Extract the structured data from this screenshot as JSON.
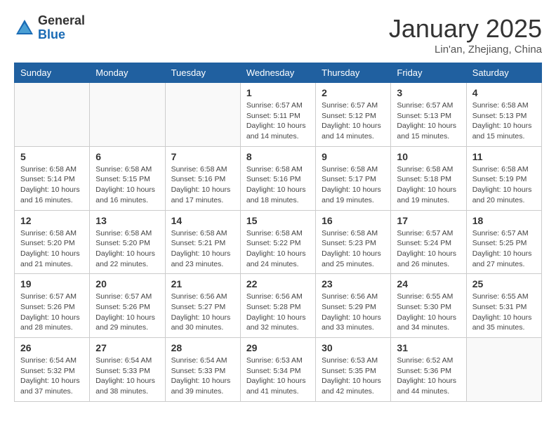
{
  "header": {
    "logo_general": "General",
    "logo_blue": "Blue",
    "month": "January 2025",
    "location": "Lin'an, Zhejiang, China"
  },
  "days_of_week": [
    "Sunday",
    "Monday",
    "Tuesday",
    "Wednesday",
    "Thursday",
    "Friday",
    "Saturday"
  ],
  "weeks": [
    [
      {
        "num": "",
        "info": ""
      },
      {
        "num": "",
        "info": ""
      },
      {
        "num": "",
        "info": ""
      },
      {
        "num": "1",
        "info": "Sunrise: 6:57 AM\nSunset: 5:11 PM\nDaylight: 10 hours\nand 14 minutes."
      },
      {
        "num": "2",
        "info": "Sunrise: 6:57 AM\nSunset: 5:12 PM\nDaylight: 10 hours\nand 14 minutes."
      },
      {
        "num": "3",
        "info": "Sunrise: 6:57 AM\nSunset: 5:13 PM\nDaylight: 10 hours\nand 15 minutes."
      },
      {
        "num": "4",
        "info": "Sunrise: 6:58 AM\nSunset: 5:13 PM\nDaylight: 10 hours\nand 15 minutes."
      }
    ],
    [
      {
        "num": "5",
        "info": "Sunrise: 6:58 AM\nSunset: 5:14 PM\nDaylight: 10 hours\nand 16 minutes."
      },
      {
        "num": "6",
        "info": "Sunrise: 6:58 AM\nSunset: 5:15 PM\nDaylight: 10 hours\nand 16 minutes."
      },
      {
        "num": "7",
        "info": "Sunrise: 6:58 AM\nSunset: 5:16 PM\nDaylight: 10 hours\nand 17 minutes."
      },
      {
        "num": "8",
        "info": "Sunrise: 6:58 AM\nSunset: 5:16 PM\nDaylight: 10 hours\nand 18 minutes."
      },
      {
        "num": "9",
        "info": "Sunrise: 6:58 AM\nSunset: 5:17 PM\nDaylight: 10 hours\nand 19 minutes."
      },
      {
        "num": "10",
        "info": "Sunrise: 6:58 AM\nSunset: 5:18 PM\nDaylight: 10 hours\nand 19 minutes."
      },
      {
        "num": "11",
        "info": "Sunrise: 6:58 AM\nSunset: 5:19 PM\nDaylight: 10 hours\nand 20 minutes."
      }
    ],
    [
      {
        "num": "12",
        "info": "Sunrise: 6:58 AM\nSunset: 5:20 PM\nDaylight: 10 hours\nand 21 minutes."
      },
      {
        "num": "13",
        "info": "Sunrise: 6:58 AM\nSunset: 5:20 PM\nDaylight: 10 hours\nand 22 minutes."
      },
      {
        "num": "14",
        "info": "Sunrise: 6:58 AM\nSunset: 5:21 PM\nDaylight: 10 hours\nand 23 minutes."
      },
      {
        "num": "15",
        "info": "Sunrise: 6:58 AM\nSunset: 5:22 PM\nDaylight: 10 hours\nand 24 minutes."
      },
      {
        "num": "16",
        "info": "Sunrise: 6:58 AM\nSunset: 5:23 PM\nDaylight: 10 hours\nand 25 minutes."
      },
      {
        "num": "17",
        "info": "Sunrise: 6:57 AM\nSunset: 5:24 PM\nDaylight: 10 hours\nand 26 minutes."
      },
      {
        "num": "18",
        "info": "Sunrise: 6:57 AM\nSunset: 5:25 PM\nDaylight: 10 hours\nand 27 minutes."
      }
    ],
    [
      {
        "num": "19",
        "info": "Sunrise: 6:57 AM\nSunset: 5:26 PM\nDaylight: 10 hours\nand 28 minutes."
      },
      {
        "num": "20",
        "info": "Sunrise: 6:57 AM\nSunset: 5:26 PM\nDaylight: 10 hours\nand 29 minutes."
      },
      {
        "num": "21",
        "info": "Sunrise: 6:56 AM\nSunset: 5:27 PM\nDaylight: 10 hours\nand 30 minutes."
      },
      {
        "num": "22",
        "info": "Sunrise: 6:56 AM\nSunset: 5:28 PM\nDaylight: 10 hours\nand 32 minutes."
      },
      {
        "num": "23",
        "info": "Sunrise: 6:56 AM\nSunset: 5:29 PM\nDaylight: 10 hours\nand 33 minutes."
      },
      {
        "num": "24",
        "info": "Sunrise: 6:55 AM\nSunset: 5:30 PM\nDaylight: 10 hours\nand 34 minutes."
      },
      {
        "num": "25",
        "info": "Sunrise: 6:55 AM\nSunset: 5:31 PM\nDaylight: 10 hours\nand 35 minutes."
      }
    ],
    [
      {
        "num": "26",
        "info": "Sunrise: 6:54 AM\nSunset: 5:32 PM\nDaylight: 10 hours\nand 37 minutes."
      },
      {
        "num": "27",
        "info": "Sunrise: 6:54 AM\nSunset: 5:33 PM\nDaylight: 10 hours\nand 38 minutes."
      },
      {
        "num": "28",
        "info": "Sunrise: 6:54 AM\nSunset: 5:33 PM\nDaylight: 10 hours\nand 39 minutes."
      },
      {
        "num": "29",
        "info": "Sunrise: 6:53 AM\nSunset: 5:34 PM\nDaylight: 10 hours\nand 41 minutes."
      },
      {
        "num": "30",
        "info": "Sunrise: 6:53 AM\nSunset: 5:35 PM\nDaylight: 10 hours\nand 42 minutes."
      },
      {
        "num": "31",
        "info": "Sunrise: 6:52 AM\nSunset: 5:36 PM\nDaylight: 10 hours\nand 44 minutes."
      },
      {
        "num": "",
        "info": ""
      }
    ]
  ]
}
